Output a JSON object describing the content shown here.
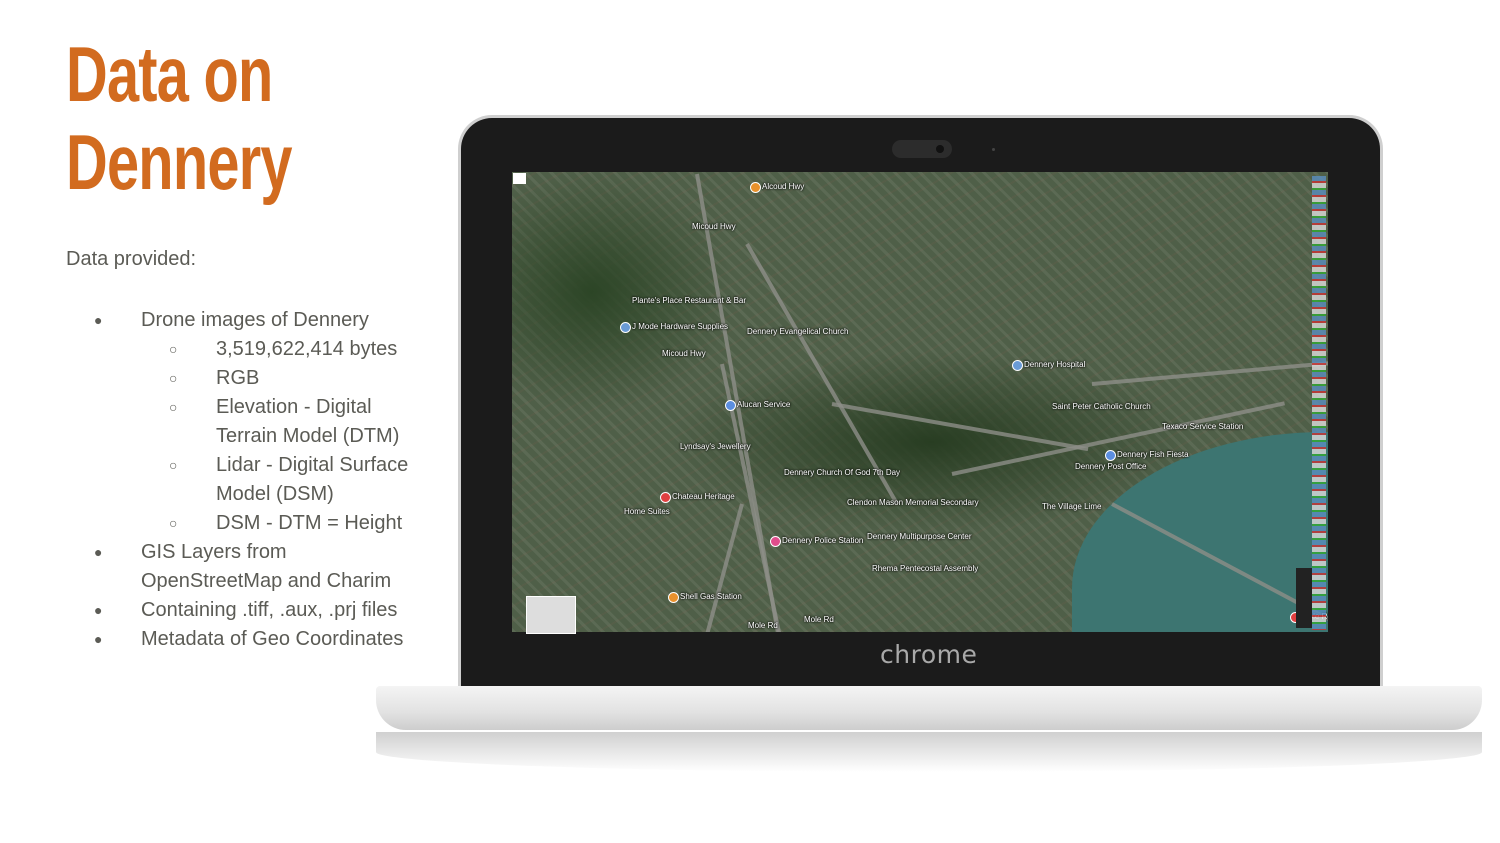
{
  "slide": {
    "title_line1": "Data on",
    "title_line2": "Dennery",
    "intro": "Data provided:",
    "title_color": "#d26b1f",
    "items": [
      {
        "level": 1,
        "text": "Drone images of Dennery"
      },
      {
        "level": 2,
        "text": "3,519,622,414 bytes"
      },
      {
        "level": 2,
        "text": "RGB"
      },
      {
        "level": 2,
        "text": "Elevation - Digital Terrain Model (DTM)"
      },
      {
        "level": 2,
        "text": "Lidar - Digital Surface Model (DSM)"
      },
      {
        "level": 2,
        "text": "DSM - DTM = Height"
      },
      {
        "level": 1,
        "text": "GIS Layers from OpenStreetMap and Charim"
      },
      {
        "level": 1,
        "text": "Containing .tiff, .aux, .prj files"
      },
      {
        "level": 1,
        "text": "Metadata of Geo Coordinates"
      }
    ]
  },
  "laptop": {
    "brand": "chrome"
  },
  "map": {
    "type": "satellite",
    "labels": [
      "Alcoud Hwy",
      "Micoud Hwy",
      "Plante's Place Restaurant & Bar",
      "J Mode Hardware Supplies",
      "Micoud Hwy",
      "Dennery Evangelical Church",
      "Alucan Service",
      "Lyndsay's Jewellery",
      "Dennery Church Of God 7th Day",
      "Chateau Heritage",
      "Home Suites",
      "Clendon Mason Memorial Secondary",
      "Dennery Police Station",
      "Dennery Multipurpose Center",
      "Rhema Pentecostal Assembly",
      "Shell Gas Station",
      "Mole Rd",
      "Mole Rd",
      "Dennery Hospital",
      "Saint Peter Catholic Church",
      "Texaco Service Station",
      "Dennery Fish Fiesta",
      "Dennery Post Office",
      "The Village Lime",
      "Mole Rd"
    ]
  }
}
